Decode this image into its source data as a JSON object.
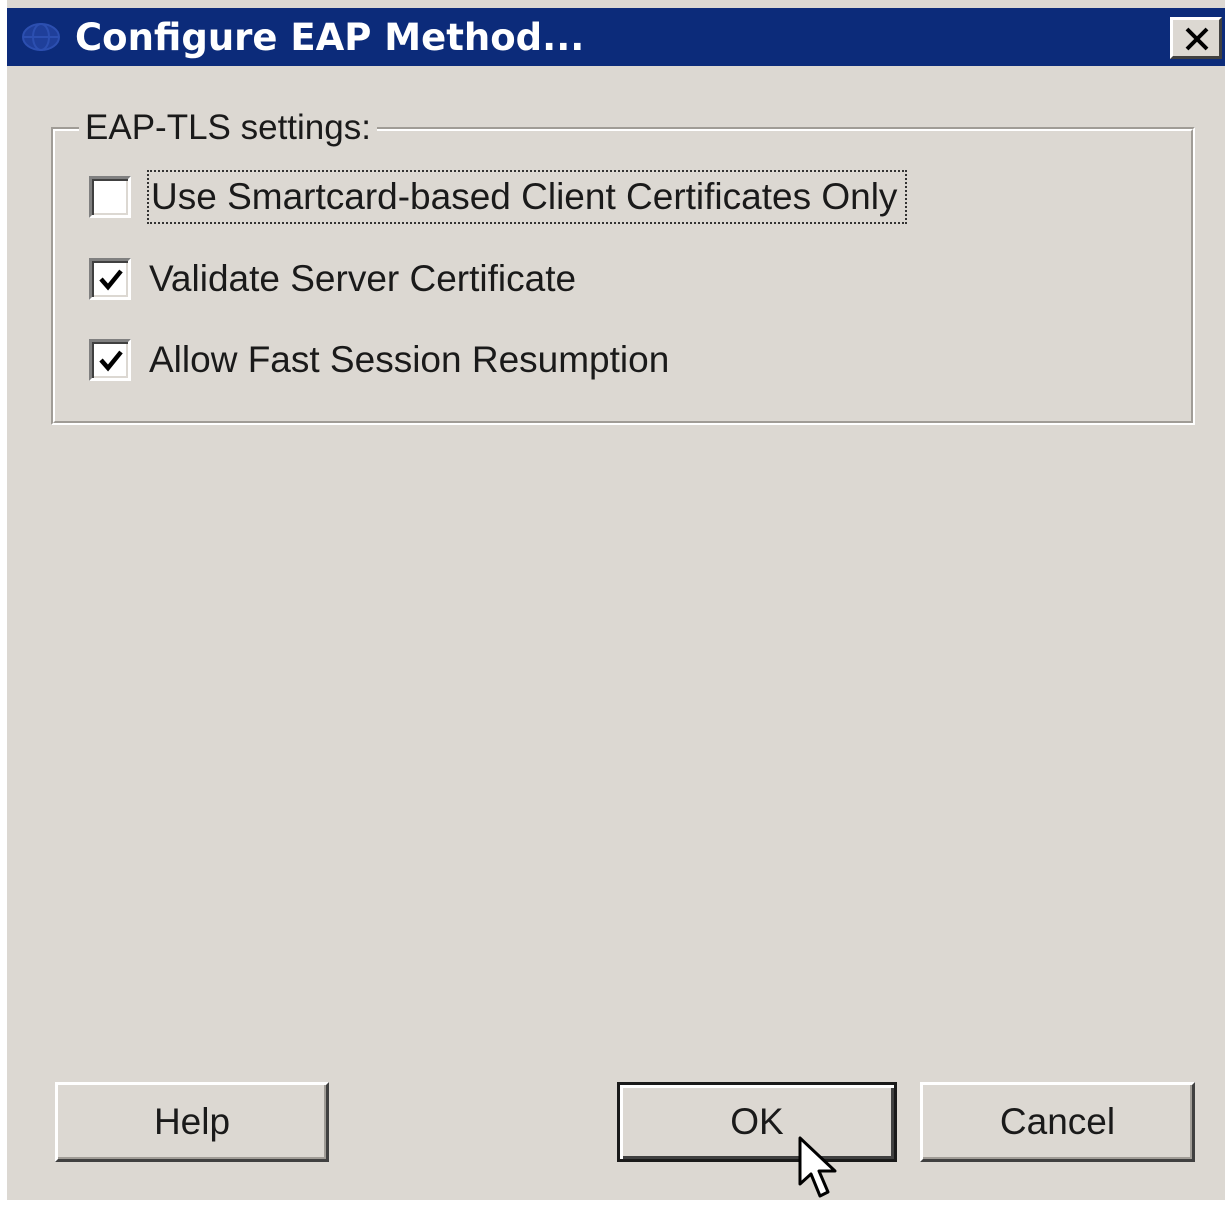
{
  "window": {
    "title": "Configure EAP Method..."
  },
  "group": {
    "label": "EAP-TLS settings:",
    "options": [
      {
        "label": "Use Smartcard-based Client Certificates Only",
        "checked": false,
        "focused": true
      },
      {
        "label": "Validate Server Certificate",
        "checked": true,
        "focused": false
      },
      {
        "label": "Allow Fast Session Resumption",
        "checked": true,
        "focused": false
      }
    ]
  },
  "buttons": {
    "help": "Help",
    "ok": "OK",
    "cancel": "Cancel"
  },
  "colors": {
    "titlebar": "#0c2b7a",
    "dialog_bg": "#dcd8d2",
    "title_text": "#ffffff"
  }
}
